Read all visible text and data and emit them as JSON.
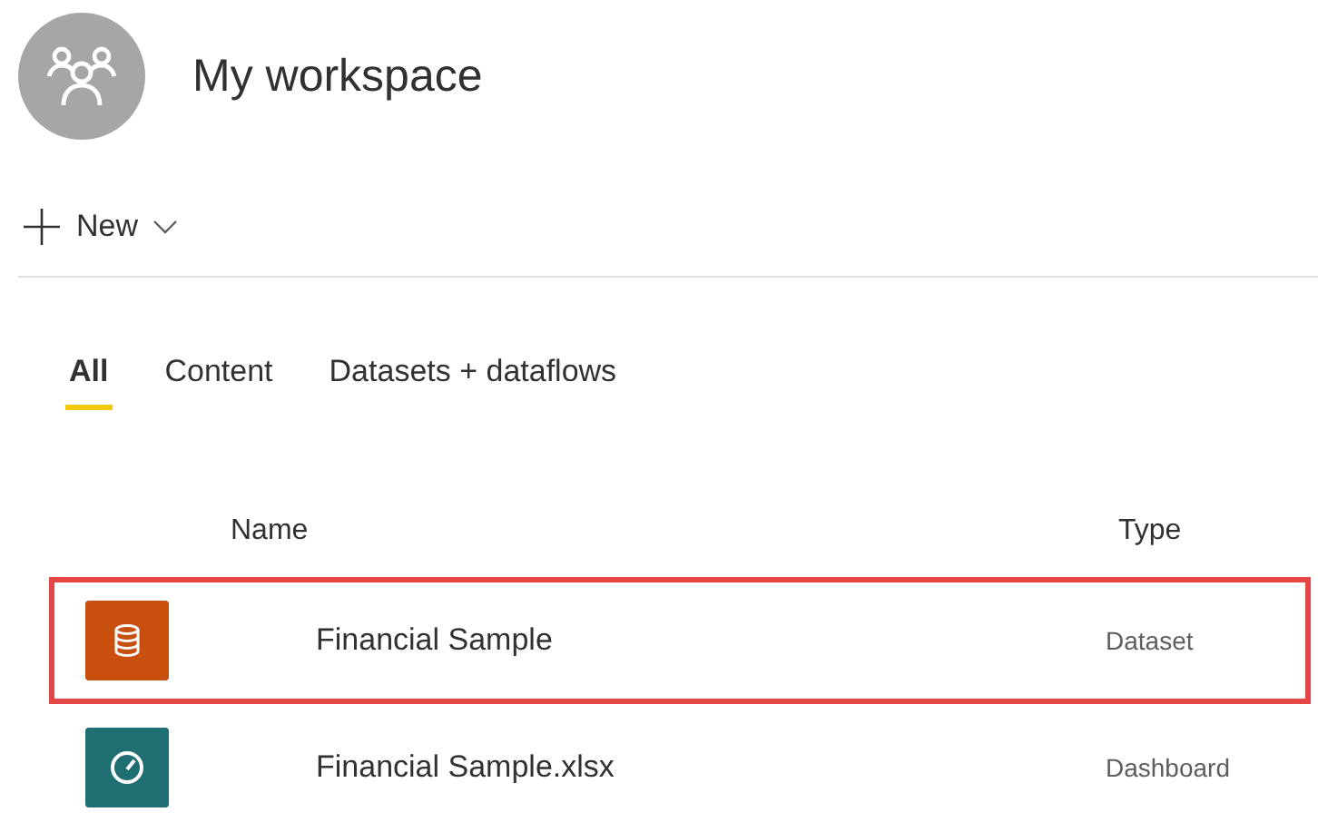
{
  "workspace": {
    "title": "My workspace"
  },
  "toolbar": {
    "new_label": "New"
  },
  "tabs": [
    {
      "label": "All",
      "selected": true
    },
    {
      "label": "Content",
      "selected": false
    },
    {
      "label": "Datasets + dataflows",
      "selected": false
    }
  ],
  "table": {
    "columns": [
      "Name",
      "Type"
    ],
    "rows": [
      {
        "kind": "dataset",
        "color": "#c94f0f",
        "name": "Financial Sample",
        "type": "Dataset",
        "highlighted": true
      },
      {
        "kind": "dashboard",
        "color": "#1f6e72",
        "name": "Financial Sample.xlsx",
        "type": "Dashboard",
        "highlighted": false
      }
    ]
  }
}
